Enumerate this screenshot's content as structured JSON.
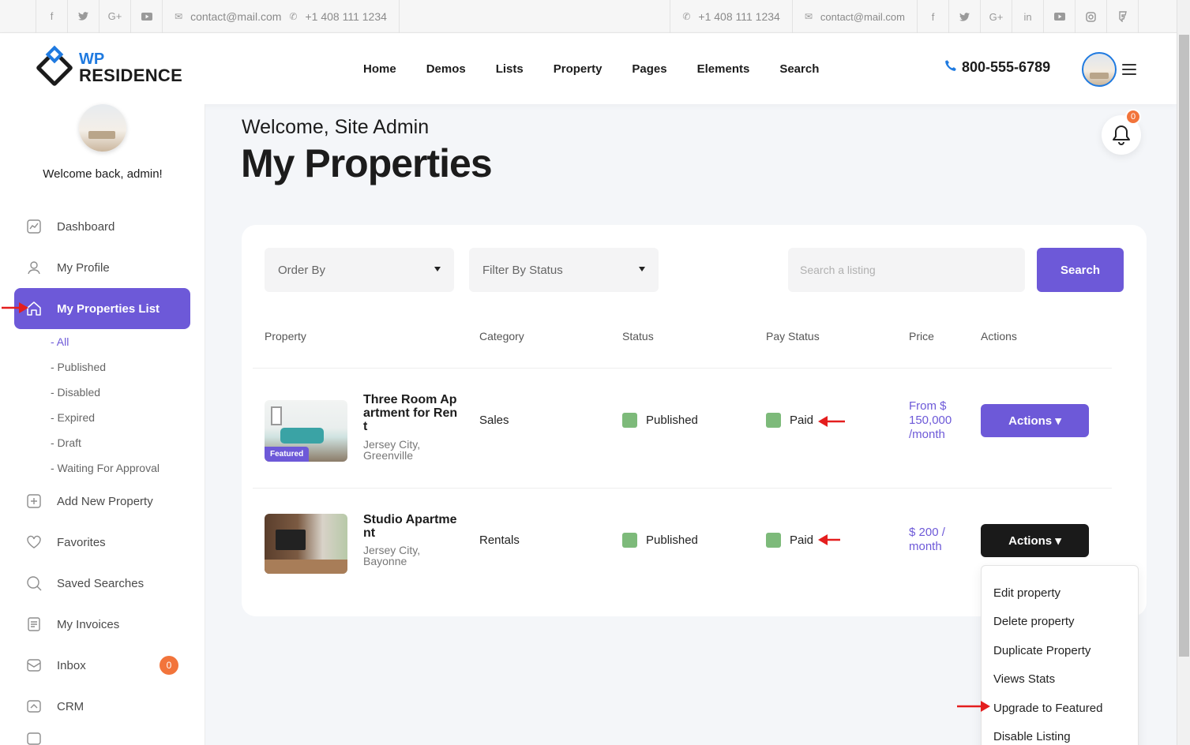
{
  "topbar": {
    "left_email": "contact@mail.com",
    "left_phone": "+1 408 111 1234",
    "right_phone": "+1 408 111 1234",
    "right_email": "contact@mail.com"
  },
  "header": {
    "logo_top": "WP",
    "logo_bottom": "RESIDENCE",
    "nav": [
      "Home",
      "Demos",
      "Lists",
      "Property",
      "Pages",
      "Elements",
      "Search"
    ],
    "phone": "800-555-6789"
  },
  "sidebar": {
    "welcome": "Welcome back, admin!",
    "items": [
      {
        "label": "Dashboard",
        "icon": "dashboard-icon"
      },
      {
        "label": "My Profile",
        "icon": "user-icon"
      },
      {
        "label": "My Properties List",
        "icon": "home-icon"
      },
      {
        "label": "Add New Property",
        "icon": "plus-square-icon"
      },
      {
        "label": "Favorites",
        "icon": "heart-icon"
      },
      {
        "label": "Saved Searches",
        "icon": "search-icon"
      },
      {
        "label": "My Invoices",
        "icon": "invoice-icon"
      },
      {
        "label": "Inbox",
        "icon": "inbox-icon",
        "badge": "0"
      },
      {
        "label": "CRM",
        "icon": "crm-icon"
      }
    ],
    "subitems": [
      "- All",
      "- Published",
      "- Disabled",
      "- Expired",
      "- Draft",
      "- Waiting For Approval"
    ]
  },
  "main": {
    "welcome": "Welcome, Site Admin",
    "title": "My Properties",
    "notif_count": "0",
    "filters": {
      "order_by": "Order By",
      "filter_status": "Filter By Status",
      "search_placeholder": "Search a listing",
      "search_button": "Search"
    },
    "columns": [
      "Property",
      "Category",
      "Status",
      "Pay Status",
      "Price",
      "Actions"
    ],
    "rows": [
      {
        "title": "Three Room Apartment for Rent",
        "location": "Jersey City, Greenville",
        "badge": "Featured",
        "category": "Sales",
        "status": "Published",
        "pay_status": "Paid",
        "price": "From $ 150,000 /month",
        "actions": "Actions ▾"
      },
      {
        "title": "Studio Apartment",
        "location": "Jersey City, Bayonne",
        "category": "Rentals",
        "status": "Published",
        "pay_status": "Paid",
        "price": "$ 200 / month",
        "actions": "Actions ▾"
      }
    ],
    "dropdown": [
      "Edit property",
      "Delete property",
      "Duplicate Property",
      "Views Stats",
      "Upgrade to Featured",
      "Disable Listing"
    ]
  },
  "colors": {
    "accent": "#6d59d8",
    "brand_blue": "#1f7ae0",
    "badge_orange": "#f2743b",
    "status_green": "#7dba7a",
    "annotation_red": "#e41e1e"
  }
}
